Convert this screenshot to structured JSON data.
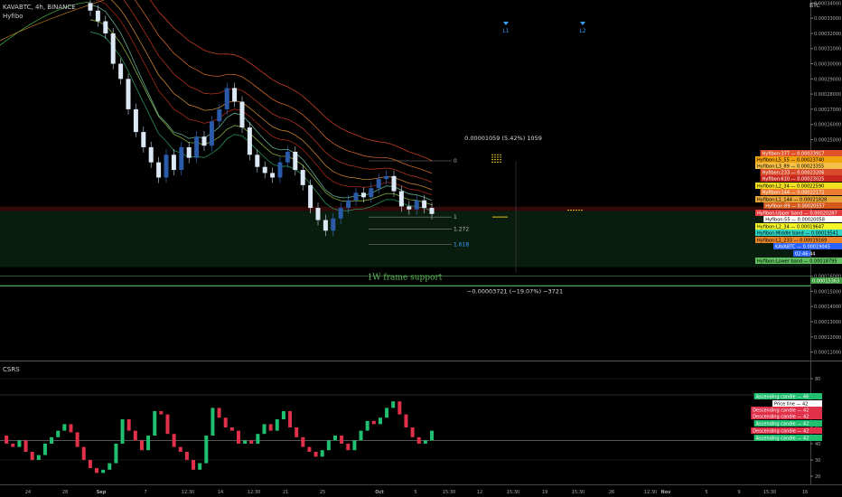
{
  "header": {
    "symbol_line": "KAVABTC, 4h, BINANCE",
    "indicator_name": "Hyfibo",
    "currency": "BTC"
  },
  "markers": [
    {
      "label": "L1",
      "x": "Oct 8 15:30"
    },
    {
      "label": "L2",
      "x": "Oct 12 15:30"
    }
  ],
  "chart_data": [
    {
      "type": "candlestick",
      "title": "KAVABTC, 4h, BINANCE",
      "currency": "BTC",
      "yaxis_ticks": [
        "0.00034000",
        "0.00033000",
        "0.00032000",
        "0.00031000",
        "0.00030000",
        "0.00029000",
        "0.00028000",
        "0.00027000",
        "0.00026000",
        "0.00025000",
        "0.00024000",
        "0.00023000",
        "0.00022000",
        "0.00021000",
        "0.00020000",
        "0.00019000",
        "0.00018000",
        "0.00017000",
        "0.00016000",
        "0.00015000",
        "0.00014000",
        "0.00013000",
        "0.00012000",
        "0.00011000"
      ],
      "ylim": [
        0.000105,
        0.000342
      ],
      "xaxis_ticks": [
        "24",
        "28",
        "Sep",
        "7",
        "12:30",
        "14",
        "12:30",
        "21",
        "25",
        "Oct",
        "5",
        "15:30",
        "12",
        "15:30",
        "19",
        "15:30",
        "26",
        "12:30",
        "Nov",
        "5",
        "9",
        "15:30",
        "16"
      ],
      "candles_close": [
        0.000335,
        0.000328,
        0.00032,
        0.0003,
        0.00029,
        0.00027,
        0.000255,
        0.000245,
        0.000235,
        0.000225,
        0.00024,
        0.00023,
        0.000245,
        0.000238,
        0.000252,
        0.000246,
        0.000262,
        0.00027,
        0.000284,
        0.000275,
        0.000258,
        0.00024,
        0.000232,
        0.000228,
        0.000225,
        0.000235,
        0.000242,
        0.00023,
        0.00022,
        0.000205,
        0.000197,
        0.00019,
        0.000198,
        0.000205,
        0.00021,
        0.000215,
        0.000212,
        0.000218,
        0.000224,
        0.000226,
        0.000216,
        0.000206,
        0.000204,
        0.00021,
        0.000205,
        0.000201
      ],
      "fib_levels": [
        {
          "ratio": "0",
          "value": 0.000236
        },
        {
          "ratio": "1",
          "value": 0.000199
        },
        {
          "ratio": "1.272",
          "value": 0.000191
        },
        {
          "ratio": "1.618",
          "value": 0.000181
        }
      ],
      "measure_up": "0.00001059 (5.42%) 1059",
      "measure_down": "−0.00003721 (−19.07%) −3721",
      "annotation": "1W frame support",
      "price_labels": [
        {
          "text": "Hyfibon:377 — 0.00023917",
          "bg": "#e0522a",
          "fg": "#ffffff",
          "value": 0.00023917
        },
        {
          "text": "Hyfibon:L5_55 — 0.00023740",
          "bg": "#f0a30a",
          "fg": "#000000",
          "value": 0.0002374
        },
        {
          "text": "Hyfibon:L3_89 — 0.00023355",
          "bg": "#f5c04a",
          "fg": "#000000",
          "value": 0.00023355
        },
        {
          "text": "Hyfibon:233 — 0.00023206",
          "bg": "#d94a2a",
          "fg": "#ffffff",
          "value": 0.00023206
        },
        {
          "text": "Hyfibon:610 — 0.00023025",
          "bg": "#c8281e",
          "fg": "#ffffff",
          "value": 0.00023025
        },
        {
          "text": "Hyfibon:L2_34 — 0.00022590",
          "bg": "#f0e020",
          "fg": "#000000",
          "value": 0.0002259
        },
        {
          "text": "Hyfibon:144 — 0.00022172",
          "bg": "#ee7a30",
          "fg": "#ffffff",
          "value": 0.00022172
        },
        {
          "text": "Hyfibon:L1_144 — 0.00021828",
          "bg": "#e8a53a",
          "fg": "#000000",
          "value": 0.00021828
        },
        {
          "text": "Hyfibon:89 — 0.00020557",
          "bg": "#d35a1c",
          "fg": "#ffffff",
          "value": 0.00020557
        },
        {
          "text": "Hyfibon:Upper band — 0.00020287",
          "bg": "#e33b3b",
          "fg": "#ffffff",
          "value": 0.00020287
        },
        {
          "text": "Hyfibon:55 — 0.00020058",
          "bg": "#ffffff",
          "fg": "#000000",
          "value": 0.00020058
        },
        {
          "text": "Hyfibon:L2_34 — 0.00019647",
          "bg": "#f5f52a",
          "fg": "#000000",
          "value": 0.00019647
        },
        {
          "text": "Hyfibon:Middle band — 0.00019541",
          "bg": "#2fd3c0",
          "fg": "#000000",
          "value": 0.00019541
        },
        {
          "text": "Hyfibon:L1_233 — 0.00019169",
          "bg": "#e8842a",
          "fg": "#000000",
          "value": 0.00019169
        },
        {
          "text": "KAVABTC — 0.00019045",
          "bg": "#2962ff",
          "fg": "#ffffff",
          "value": 0.00019045
        },
        {
          "text": "02:46:44",
          "bg": "#2962ff",
          "fg": "#ffffff",
          "value": 0.000186
        },
        {
          "text": "Hyfibon:Lower band — 0.00018795",
          "bg": "#5fbf5f",
          "fg": "#000000",
          "value": 0.00018795
        },
        {
          "text": "0.00015363",
          "bg": "#3a9a3a",
          "fg": "#ffffff",
          "value": 0.00015363
        }
      ]
    },
    {
      "type": "line",
      "title": "CSRS",
      "ylim": [
        15,
        90
      ],
      "yaxis_ticks": [
        "80",
        "70",
        "60",
        "50",
        "40",
        "30",
        "20"
      ],
      "values": [
        45,
        40,
        38,
        42,
        35,
        30,
        33,
        40,
        44,
        48,
        52,
        47,
        38,
        30,
        25,
        22,
        24,
        28,
        40,
        55,
        48,
        42,
        36,
        45,
        60,
        58,
        46,
        38,
        35,
        30,
        24,
        28,
        45,
        62,
        56,
        50,
        48,
        40,
        42,
        40,
        46,
        52,
        48,
        55,
        60,
        50,
        44,
        38,
        35,
        32,
        36,
        42,
        45,
        40,
        36,
        42,
        48,
        54,
        52,
        56,
        62,
        66,
        58,
        50,
        44,
        40,
        42,
        48
      ],
      "price_labels": [
        {
          "text": "Ascending candle — 46",
          "bg": "#20c070",
          "fg": "#ffffff",
          "value": 46
        },
        {
          "text": "Price line — 42",
          "bg": "#ffffff",
          "fg": "#000000",
          "value": 42
        },
        {
          "text": "Descending candle — 42",
          "bg": "#e0304a",
          "fg": "#ffffff",
          "value": 42
        },
        {
          "text": "Descending candle — 42",
          "bg": "#e0304a",
          "fg": "#ffffff",
          "value": 42
        },
        {
          "text": "Ascending candle — 42",
          "bg": "#20c070",
          "fg": "#ffffff",
          "value": 42
        },
        {
          "text": "Descending candle — 42",
          "bg": "#e0304a",
          "fg": "#ffffff",
          "value": 42
        },
        {
          "text": "Ascending candle — 42",
          "bg": "#20c070",
          "fg": "#ffffff",
          "value": 42
        }
      ]
    }
  ]
}
